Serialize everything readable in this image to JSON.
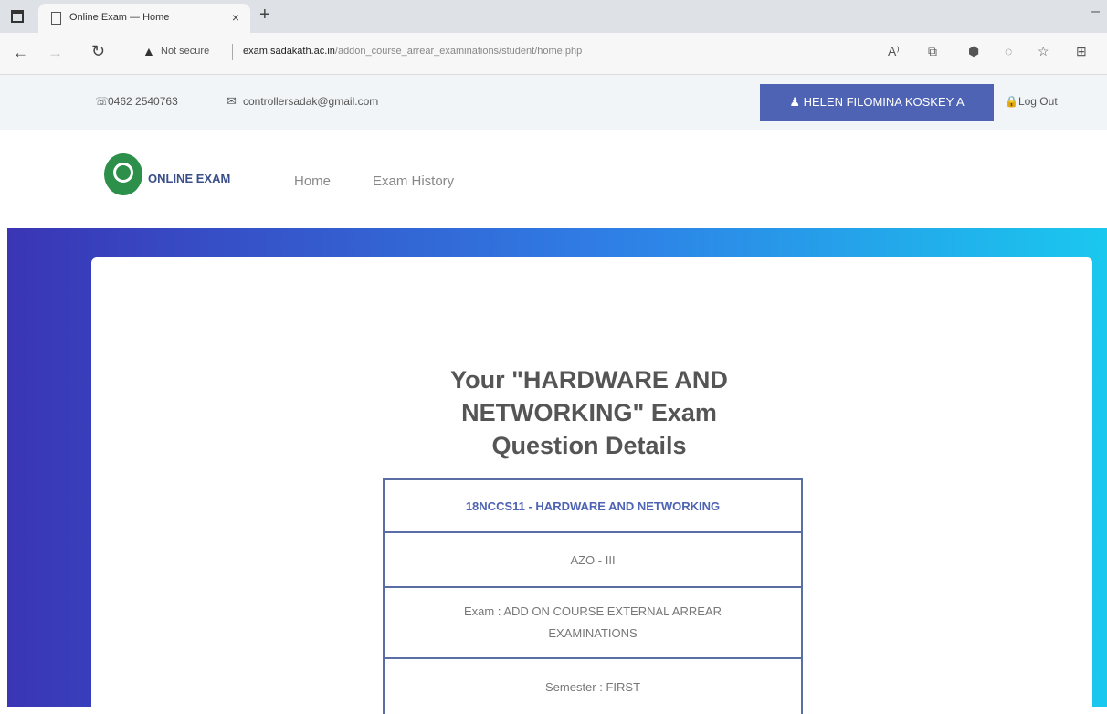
{
  "browser": {
    "tab_title": "Online Exam — Home",
    "tab_close": "×",
    "new_tab": "+",
    "minimize": "–",
    "not_secure": "Not secure",
    "url_host": "exam.sadakath.ac.in",
    "url_path": "/addon_course_arrear_examinations/student/home.php"
  },
  "contact": {
    "phone": "0462 2540763",
    "email": "controllersadak@gmail.com"
  },
  "user": {
    "name": "HELEN FILOMINA KOSKEY A",
    "logout_label": "Log Out"
  },
  "nav": {
    "brand": "ONLINE EXAM",
    "home": "Home",
    "history": "Exam History"
  },
  "exam": {
    "heading": "Your \"HARDWARE AND NETWORKING\" Exam Question Details",
    "course": "18NCCS11 - HARDWARE AND NETWORKING",
    "class": "AZO - III",
    "exam_name": "Exam : ADD ON COURSE EXTERNAL ARREAR EXAMINATIONS",
    "semester": "Semester : FIRST"
  },
  "colors": {
    "accent": "#4e63b3",
    "gradient_start": "#3a35b5",
    "gradient_end": "#1ac8ee"
  }
}
